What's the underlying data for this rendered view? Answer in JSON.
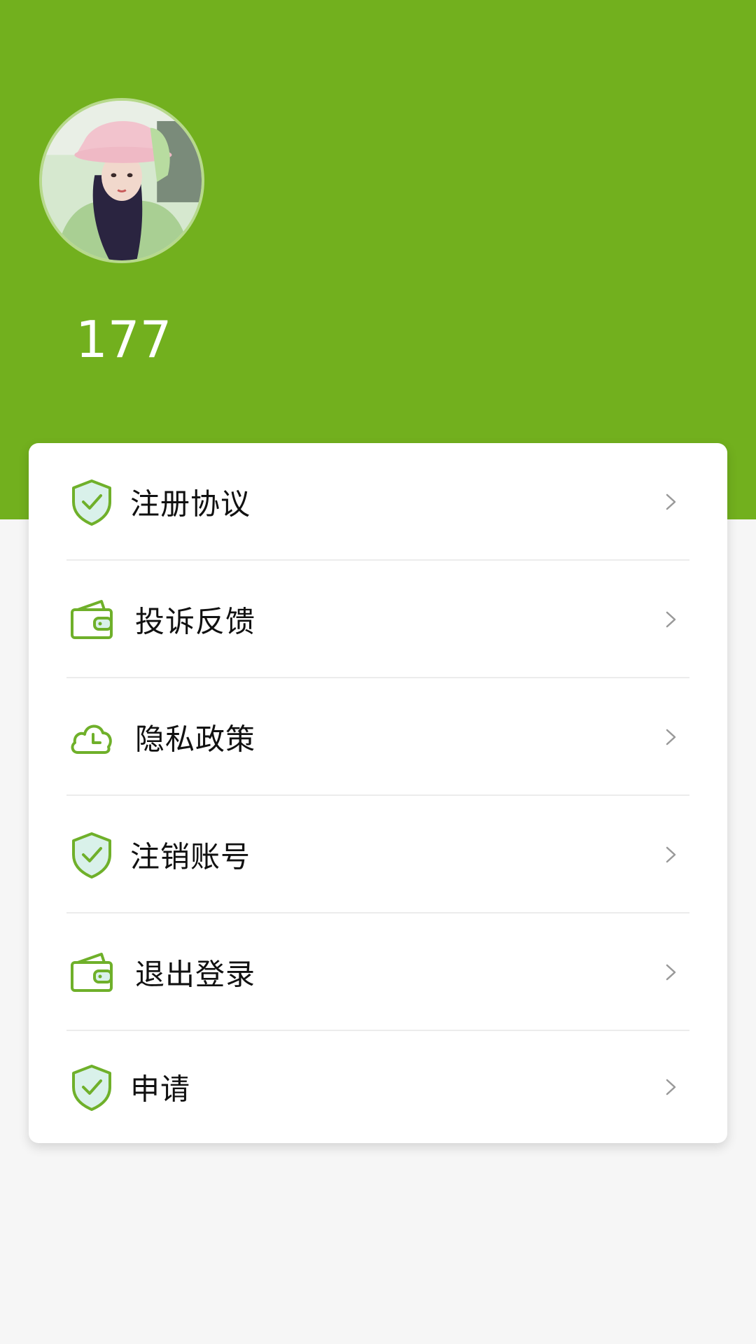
{
  "profile": {
    "username": "177",
    "avatar_icon": "user-photo-avatar"
  },
  "colors": {
    "header": "#72b01e",
    "icon_stroke": "#6fb02a",
    "icon_fill": "#d9f1ea",
    "background": "#f6f6f6"
  },
  "menu": {
    "items": [
      {
        "label": "注册协议",
        "icon": "shield-check-icon"
      },
      {
        "label": "投诉反馈",
        "icon": "wallet-icon"
      },
      {
        "label": "隐私政策",
        "icon": "cloud-clock-icon"
      },
      {
        "label": "注销账号",
        "icon": "shield-check-icon"
      },
      {
        "label": "退出登录",
        "icon": "wallet-icon"
      },
      {
        "label": "申请",
        "icon": "shield-check-icon"
      }
    ],
    "chevron_icon": "chevron-right-icon"
  }
}
